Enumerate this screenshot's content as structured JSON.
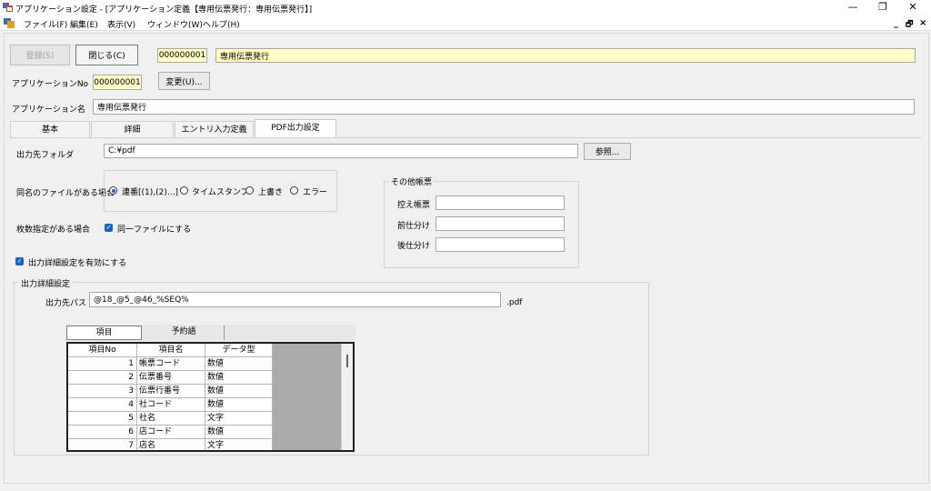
{
  "window": {
    "title": "アプリケーション設定 - [アプリケーション定義【専用伝票発行：専用伝票発行】]",
    "minimize": "—",
    "restore": "❐",
    "close": "✕"
  },
  "menu": {
    "items": [
      "ファイル(F)",
      "編集(E)",
      "表示(V)",
      "ウィンドウ(W)",
      "ヘルプ(H)"
    ],
    "mdi_min": "_",
    "mdi_restore": "🗗",
    "mdi_close": "×"
  },
  "toolbar": {
    "register_label": "登録(S)",
    "close_label": "閉じる(C)",
    "id_value": "000000001",
    "name_value": "専用伝票発行"
  },
  "app": {
    "no_label": "アプリケーションNo",
    "no_value": "000000001",
    "change_label": "変更(U)...",
    "name_label": "アプリケーション名",
    "name_value": "専用伝票発行"
  },
  "tabs": [
    "基本",
    "詳細",
    "エントリ入力定義",
    "PDF出力設定"
  ],
  "pdf": {
    "folder_label": "出力先フォルダ",
    "folder_value": "C:¥pdf",
    "browse_label": "参照...",
    "same_name_label": "同名のファイルがある場合",
    "options": [
      "連番[(1),(2)...]",
      "タイムスタンプ",
      "上書き",
      "エラー"
    ],
    "selected_option": 0,
    "count_label": "枚数指定がある場合",
    "same_file_label": "同一ファイルにする",
    "detail_enable_label": "出力詳細設定を有効にする",
    "other_group_label": "その他帳票",
    "other_fields": [
      {
        "label": "控え帳票",
        "value": ""
      },
      {
        "label": "前仕分け",
        "value": ""
      },
      {
        "label": "後仕分け",
        "value": ""
      }
    ],
    "detail_group_label": "出力詳細設定",
    "path_label": "出力先パス",
    "path_value": "@18_@5_@46_%SEQ%",
    "extension": ".pdf",
    "subtabs": [
      "項目",
      "予約語"
    ]
  },
  "grid": {
    "headers": [
      "項目No",
      "項目名",
      "データ型"
    ],
    "rows": [
      {
        "no": "1",
        "name": "帳票コード",
        "type": "数値"
      },
      {
        "no": "2",
        "name": "伝票番号",
        "type": "数値"
      },
      {
        "no": "3",
        "name": "伝票行番号",
        "type": "数値"
      },
      {
        "no": "4",
        "name": "社コード",
        "type": "数値"
      },
      {
        "no": "5",
        "name": "社名",
        "type": "文字"
      },
      {
        "no": "6",
        "name": "店コード",
        "type": "数値"
      },
      {
        "no": "7",
        "name": "店名",
        "type": "文字"
      }
    ]
  },
  "colors": {
    "accent": "#1a64c8",
    "highlight_field": "#ffffc6"
  }
}
